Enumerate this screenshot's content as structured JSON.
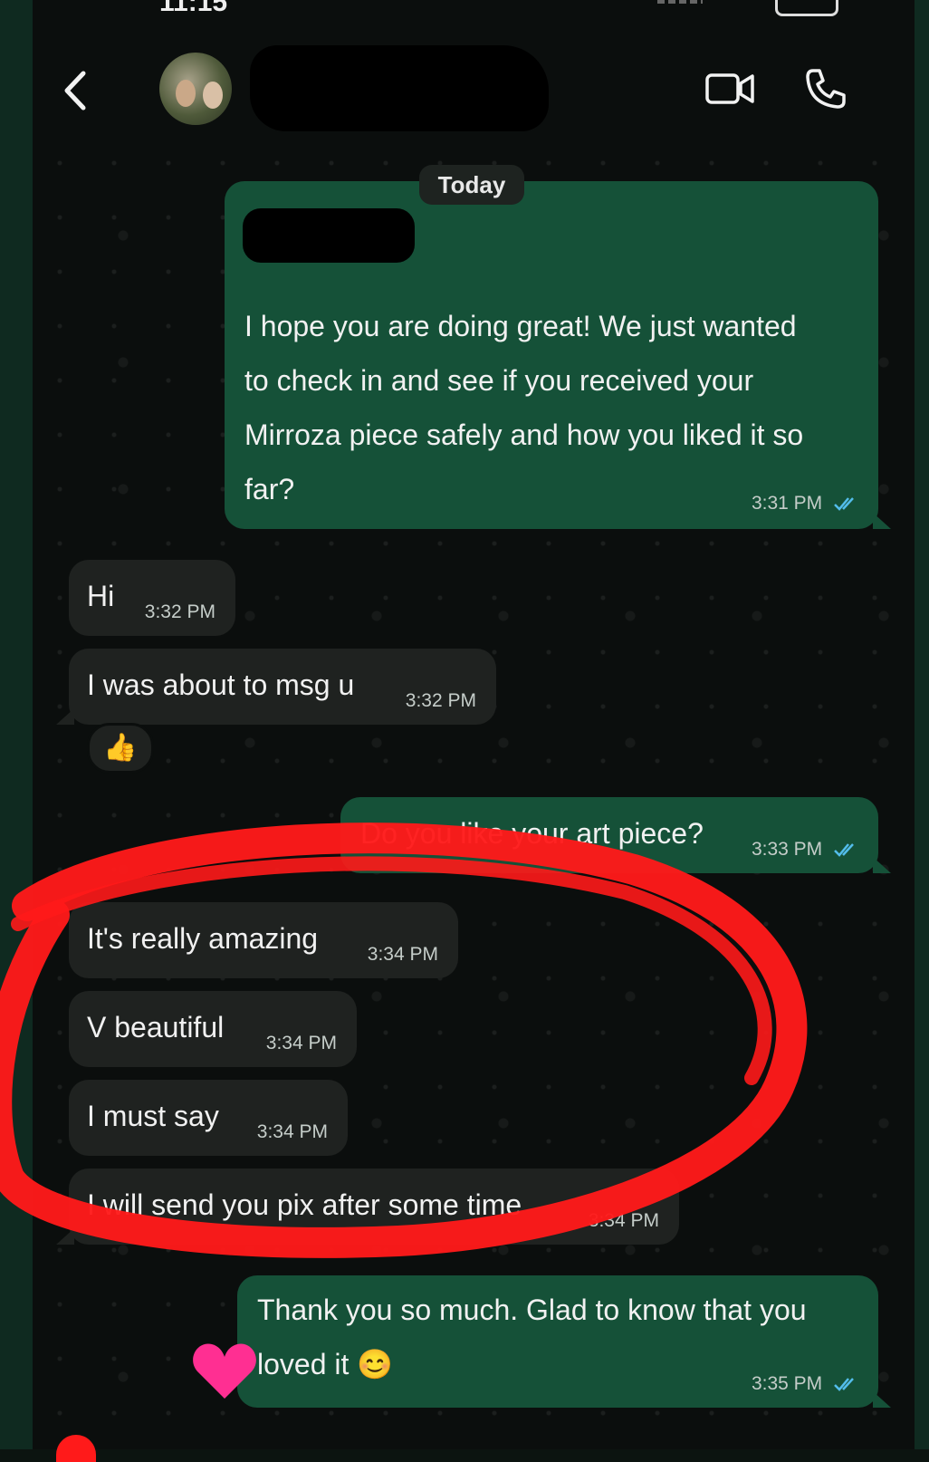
{
  "status": {
    "time": "11:15"
  },
  "header": {
    "contact_name": ""
  },
  "chat": {
    "date_label": "Today",
    "messages": [
      {
        "id": "m1",
        "text_lines": [
          "I hope you are doing great! We just wanted",
          "to check in and see if you received your",
          "Mirroza piece safely and how you liked it so",
          "far?"
        ],
        "time": "3:31 PM"
      },
      {
        "id": "m2",
        "text": "Hi",
        "time": "3:32 PM"
      },
      {
        "id": "m3",
        "text": "I was about to msg u",
        "time": "3:32 PM",
        "reaction": "👍"
      },
      {
        "id": "m4",
        "text": "Do you like your art piece?",
        "time": "3:33 PM"
      },
      {
        "id": "m5",
        "text": "It's really amazing",
        "time": "3:34 PM"
      },
      {
        "id": "m6",
        "text": "V beautiful",
        "time": "3:34 PM"
      },
      {
        "id": "m7",
        "text": "I must say",
        "time": "3:34 PM"
      },
      {
        "id": "m8",
        "text": "I will send you pix after some time",
        "time": "3:34 PM"
      },
      {
        "id": "m9",
        "text_lines": [
          "Thank you so much. Glad to know that you",
          "loved it 😊"
        ],
        "time": "3:35 PM"
      }
    ]
  },
  "colors": {
    "outgoing_bubble": "#155138",
    "incoming_bubble": "#1f2220",
    "read_ticks": "#53bdeb",
    "annotation_circle": "#ff1a1a",
    "heart": "#ff2f92"
  },
  "icons": [
    "back-chevron",
    "video-camera",
    "phone"
  ]
}
